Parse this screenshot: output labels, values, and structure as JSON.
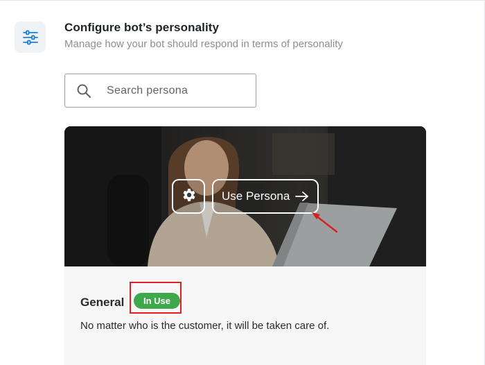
{
  "header": {
    "title": "Configure bot’s personality",
    "subtitle": "Manage how your bot should respond in terms of personality",
    "icon": "sliders-icon"
  },
  "search": {
    "placeholder": "Search persona",
    "value": "",
    "icon": "search-icon"
  },
  "persona_card": {
    "image": "woman-at-laptop-photo",
    "settings_icon": "gear-icon",
    "use_button_label": "Use Persona",
    "use_button_icon": "arrow-right-icon",
    "name": "General",
    "status_badge": "In Use",
    "description": "No matter who is the customer, it will be taken care of."
  },
  "colors": {
    "accent_blue": "#1b7fd6",
    "badge_green": "#3ea84a",
    "annotation_red": "#e02020"
  }
}
